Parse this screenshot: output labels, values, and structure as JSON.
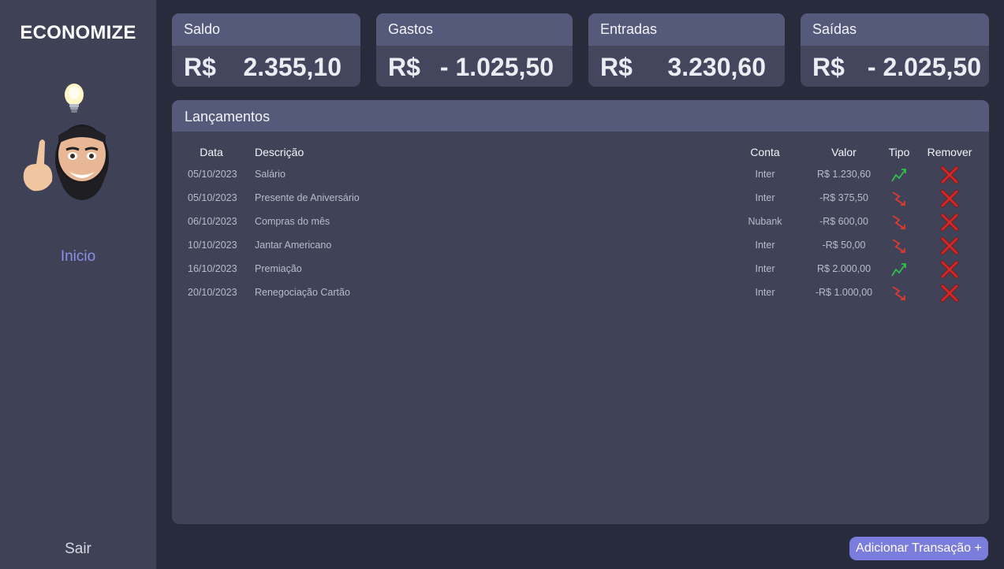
{
  "sidebar": {
    "brand": "ECONOMIZE",
    "nav": {
      "inicio": "Inicio",
      "sair": "Sair"
    }
  },
  "cards": {
    "saldo": {
      "title": "Saldo",
      "currency": "R$",
      "value": "2.355,10"
    },
    "gastos": {
      "title": "Gastos",
      "currency": "R$",
      "value": "- 1.025,50"
    },
    "entradas": {
      "title": "Entradas",
      "currency": "R$",
      "value": "3.230,60"
    },
    "saidas": {
      "title": "Saídas",
      "currency": "R$",
      "value": "- 2.025,50"
    }
  },
  "lancamentos": {
    "title": "Lançamentos",
    "columns": {
      "data": "Data",
      "descricao": "Descrição",
      "conta": "Conta",
      "valor": "Valor",
      "tipo": "Tipo",
      "remover": "Remover"
    },
    "rows": [
      {
        "data": "05/10/2023",
        "descricao": "Salário",
        "conta": "Inter",
        "valor": "R$ 1.230,60",
        "tipo": "up-trend-icon"
      },
      {
        "data": "05/10/2023",
        "descricao": "Presente de Aniversário",
        "conta": "Inter",
        "valor": "-R$ 375,50",
        "tipo": "down-trend-icon"
      },
      {
        "data": "06/10/2023",
        "descricao": "Compras do mês",
        "conta": "Nubank",
        "valor": "-R$ 600,00",
        "tipo": "down-trend-icon"
      },
      {
        "data": "10/10/2023",
        "descricao": "Jantar Americano",
        "conta": "Inter",
        "valor": "-R$ 50,00",
        "tipo": "down-trend-icon"
      },
      {
        "data": "16/10/2023",
        "descricao": "Premiação",
        "conta": "Inter",
        "valor": "R$ 2.000,00",
        "tipo": "up-trend-icon"
      },
      {
        "data": "20/10/2023",
        "descricao": "Renegociação Cartão",
        "conta": "Inter",
        "valor": "-R$ 1.000,00",
        "tipo": "down-trend-icon"
      }
    ]
  },
  "actions": {
    "add_transaction": "Adicionar Transação +"
  },
  "colors": {
    "accent": "#7a7ddb",
    "nav_active": "#8b8fe8",
    "up_trend": "#2fbf4a",
    "down_trend": "#e03a2e",
    "remove": "#d22a2a"
  }
}
